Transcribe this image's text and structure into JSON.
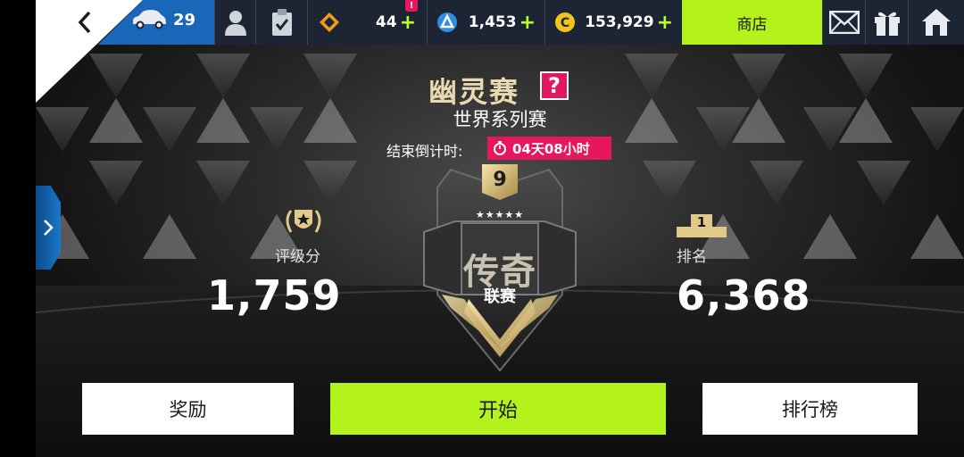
{
  "topbar": {
    "cars_count": "29",
    "token_amount": "44",
    "blueprint_amount": "1,453",
    "credits_amount": "153,929",
    "notification_badge": "!",
    "shop_label": "商店"
  },
  "event": {
    "title": "幽灵赛",
    "help_label": "?",
    "subtitle": "世界系列赛",
    "countdown_label": "结束倒计时:",
    "countdown_value": "04天08小时"
  },
  "league": {
    "badge_number": "9",
    "stars": "★★★★★",
    "tier_name": "传奇",
    "league_label": "联赛"
  },
  "stats": {
    "rating_label": "评级分",
    "rating_value": "1,759",
    "rank_label": "排名",
    "rank_podium": "1",
    "rank_value": "6,368"
  },
  "buttons": {
    "rewards": "奖励",
    "start": "开始",
    "leaderboard": "排行榜"
  },
  "colors": {
    "accent_green": "#b4f21c",
    "countdown_pink": "#e8175d",
    "gold": "#e0c98a"
  }
}
